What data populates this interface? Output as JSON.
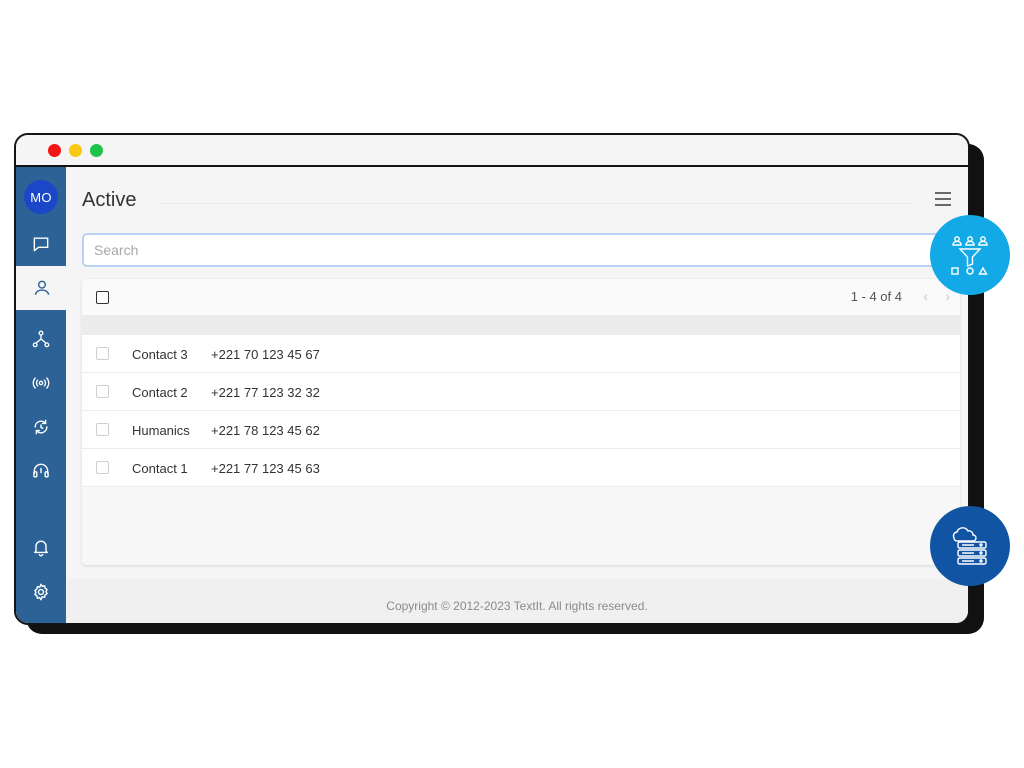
{
  "window": {
    "controls": [
      "close",
      "minimize",
      "maximize"
    ]
  },
  "sidebar": {
    "avatar_initials": "MO",
    "items": [
      {
        "name": "messages",
        "icon": "chat-bubble-icon",
        "active": false
      },
      {
        "name": "contacts",
        "icon": "user-icon",
        "active": true
      },
      {
        "name": "flows",
        "icon": "flow-icon",
        "active": false
      },
      {
        "name": "channels",
        "icon": "broadcast-icon",
        "active": false
      },
      {
        "name": "triggers",
        "icon": "refresh-icon",
        "active": false
      },
      {
        "name": "support",
        "icon": "headset-icon",
        "active": false
      },
      {
        "name": "notifications",
        "icon": "bell-icon",
        "active": false
      },
      {
        "name": "settings",
        "icon": "gear-icon",
        "active": false
      }
    ]
  },
  "header": {
    "title": "Active"
  },
  "search": {
    "placeholder": "Search",
    "value": ""
  },
  "table": {
    "pager_text": "1 - 4 of 4",
    "pager_prev": "‹",
    "pager_next": "›",
    "rows": [
      {
        "name": "Contact 3",
        "phone": "+221 70 123 45 67"
      },
      {
        "name": "Contact 2",
        "phone": "+221 77 123 32 32"
      },
      {
        "name": "Humanics",
        "phone": "+221 78 123 45 62"
      },
      {
        "name": "Contact 1",
        "phone": "+221 77 123 45 63"
      }
    ]
  },
  "footer": {
    "copyright": "Copyright © 2012-2023 TextIt. All rights reserved."
  },
  "colors": {
    "sidebar": "#2c6296",
    "avatar": "#1a47c7",
    "fab_funnel": "#12a9e6",
    "fab_server": "#1154a3"
  },
  "floating_icons": [
    "audience-funnel-icon",
    "cloud-server-icon"
  ]
}
